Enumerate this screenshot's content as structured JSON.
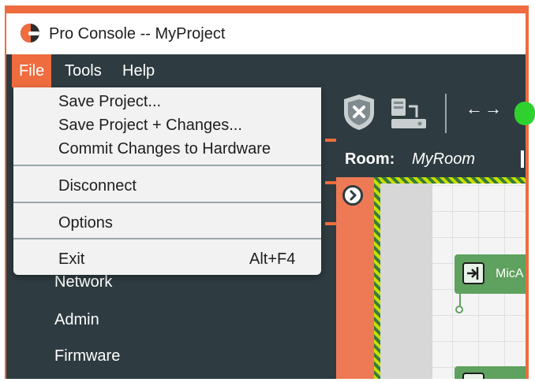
{
  "window": {
    "app_name": "Pro Console",
    "title": "Pro Console  -- MyProject"
  },
  "menubar": {
    "file": "File",
    "tools": "Tools",
    "help": "Help"
  },
  "file_menu": {
    "items": [
      {
        "label": "Save Project..."
      },
      {
        "label": "Save Project + Changes..."
      },
      {
        "label": "Commit Changes to Hardware"
      },
      {
        "label": "Disconnect"
      },
      {
        "label": "Options"
      },
      {
        "label": "Exit",
        "shortcut": "Alt+F4"
      }
    ]
  },
  "sidebar": {
    "items": [
      {
        "label": "Network"
      },
      {
        "label": "Admin"
      },
      {
        "label": "Firmware"
      }
    ]
  },
  "room": {
    "label": "Room:",
    "name": "MyRoom"
  },
  "canvas": {
    "node_label": "MicA"
  },
  "colors": {
    "accent": "#ee6c3e",
    "dark": "#2e3b40",
    "node": "#5fa15f",
    "status_green": "#2ed12e"
  },
  "icons": [
    "logo-icon",
    "shield-x-icon",
    "hardware-sync-icon",
    "arrows-icon",
    "status-indicator-icon",
    "chevron-right-icon",
    "input-node-icon"
  ]
}
